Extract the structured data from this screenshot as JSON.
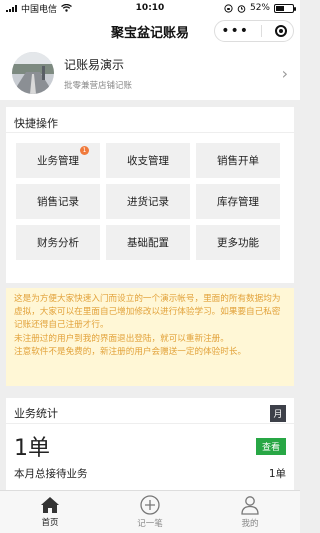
{
  "status": {
    "carrier": "中国电信",
    "time": "10:10",
    "battery": "52%",
    "battery_level": 0.52
  },
  "nav": {
    "title": "聚宝盆记账易",
    "more_icon": "more-dots-icon",
    "close_icon": "target-circle-icon"
  },
  "profile": {
    "name": "记账易演示",
    "subtitle": "批零兼营店铺记账",
    "avatar_icon": "road-photo-avatar"
  },
  "quick": {
    "title": "快捷操作",
    "items": [
      {
        "label": "业务管理",
        "badge": "1"
      },
      {
        "label": "收支管理"
      },
      {
        "label": "销售开单"
      },
      {
        "label": "销售记录"
      },
      {
        "label": "进货记录"
      },
      {
        "label": "库存管理"
      },
      {
        "label": "财务分析"
      },
      {
        "label": "基础配置"
      },
      {
        "label": "更多功能"
      }
    ]
  },
  "notice": {
    "lines": [
      "这是为方便大家快速入门而设立的一个演示帐号，里面的所有数据均为虚拟，大家可以在里面自己增加修改以进行体验学习。如果要自己私密记账还得自己注册才行。",
      "未注册过的用户到我的界面退出登陆，就可以重新注册。",
      "注意软件不是免费的，新注册的用户会赠送一定的体验时长。"
    ],
    "color": "#e2a23a",
    "background": "#fff7d6"
  },
  "stats": {
    "title": "业务统计",
    "period_button": "月",
    "count": "1单",
    "view_button": "查看",
    "footer_label": "本月总接待业务",
    "footer_value": "1单"
  },
  "tabs": [
    {
      "label": "首页",
      "icon": "home-icon",
      "active": true
    },
    {
      "label": "记一笔",
      "icon": "plus-circle-icon",
      "active": false
    },
    {
      "label": "我的",
      "icon": "user-icon",
      "active": false
    }
  ]
}
